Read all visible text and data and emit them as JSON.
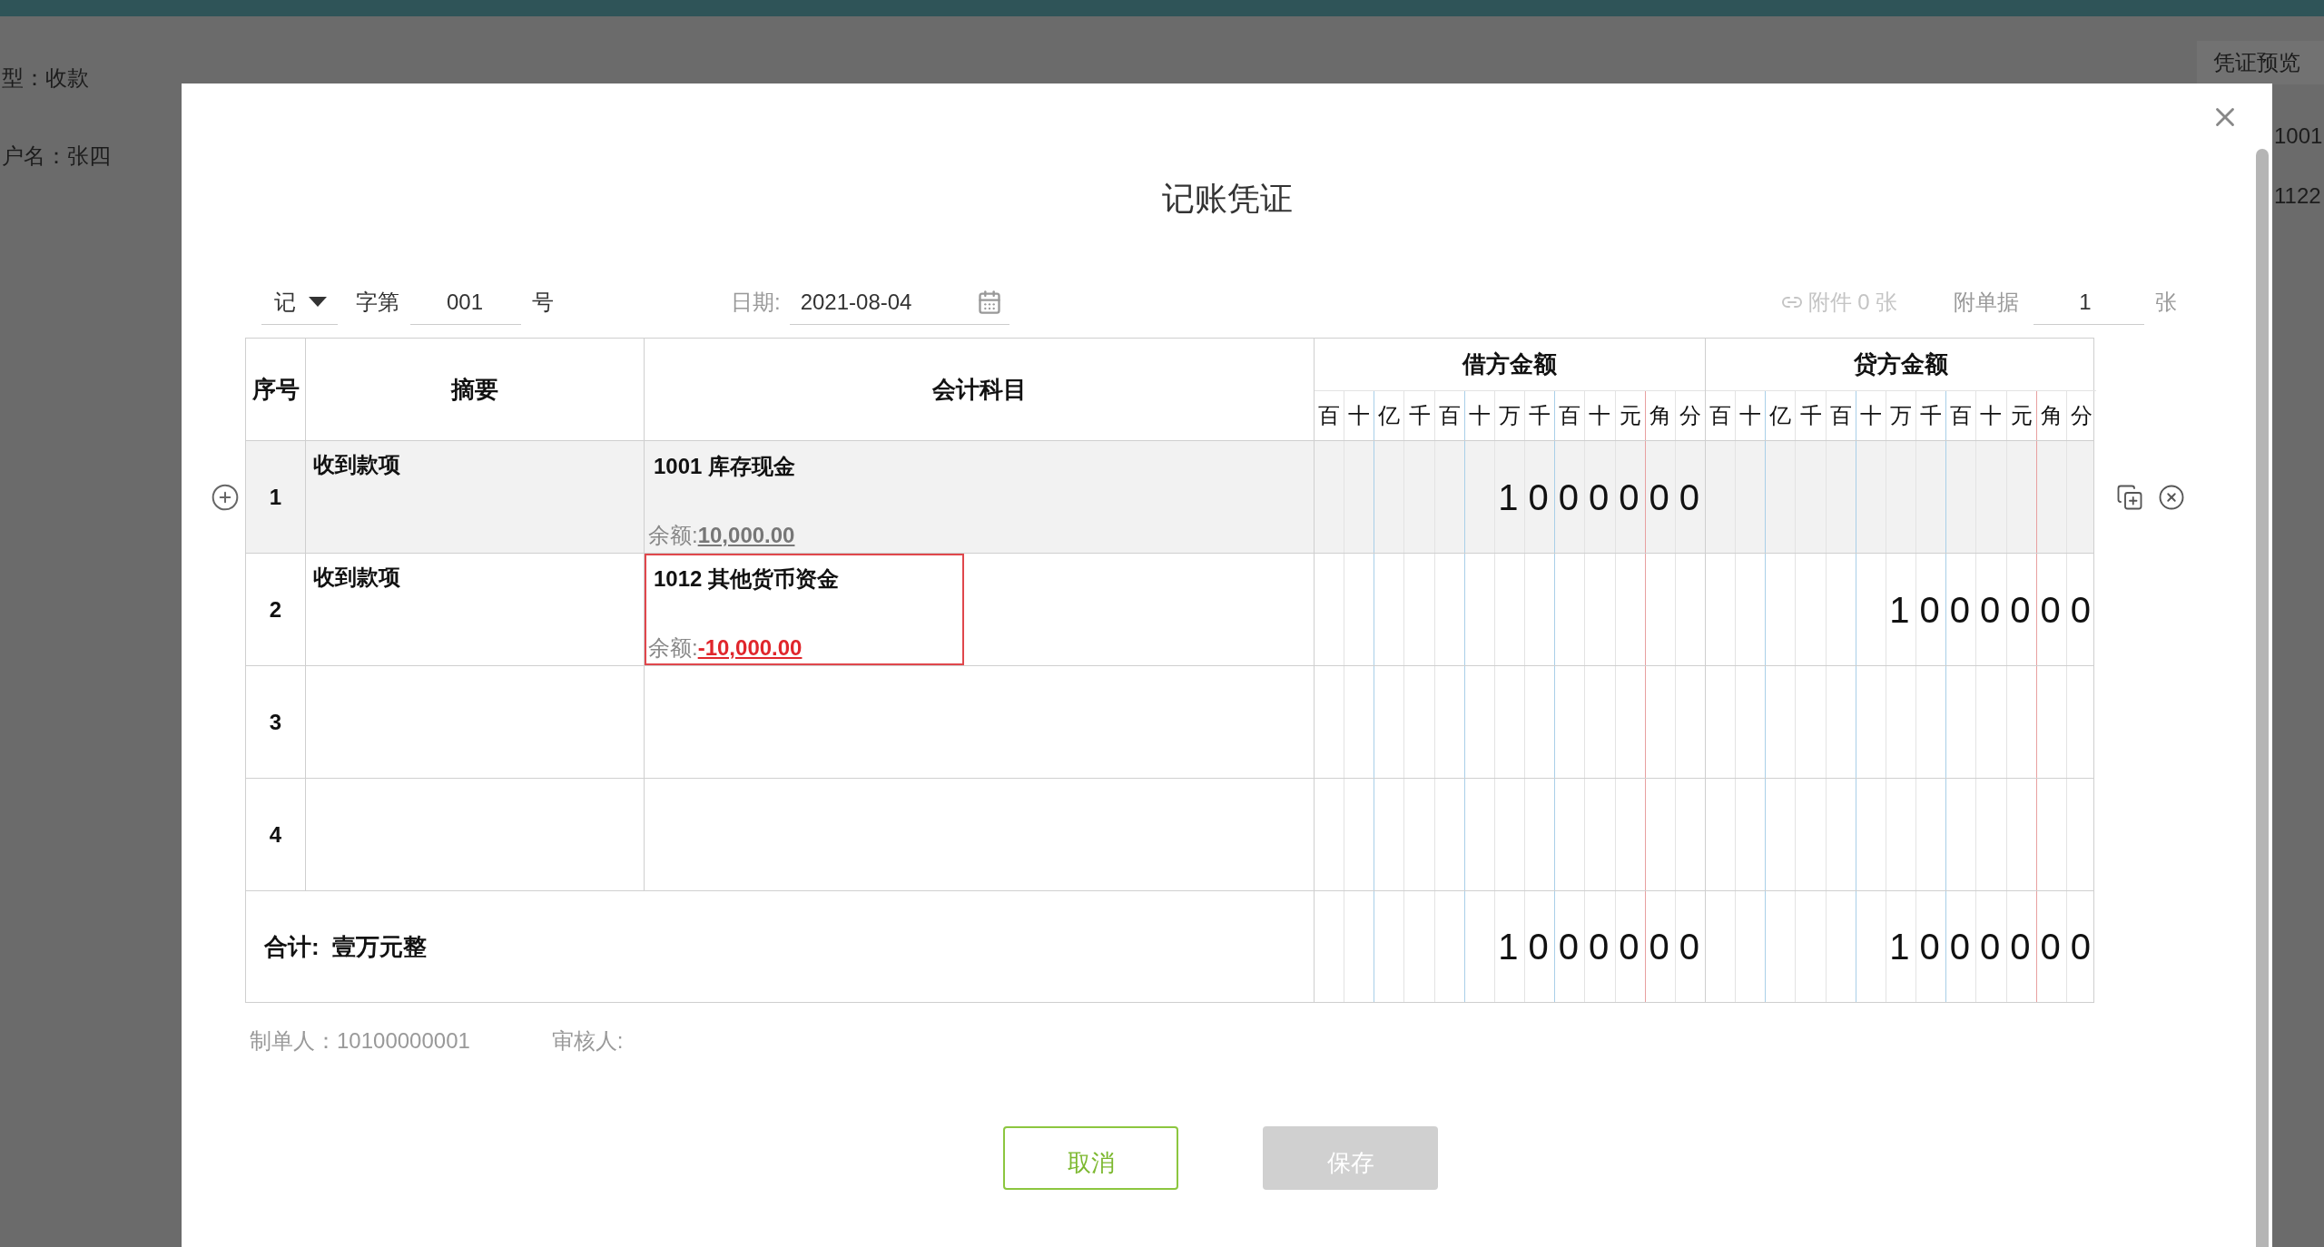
{
  "background": {
    "fields": [
      "型：收款",
      "户名：张四"
    ],
    "preview_tab": "凭证预览",
    "codes": [
      "1001",
      "1122"
    ]
  },
  "dialog": {
    "title": "记账凭证",
    "toolbar": {
      "voucher_type": "记",
      "word_label": "字第",
      "number": "001",
      "number_suffix": "号",
      "date_label": "日期:",
      "date": "2021-08-04",
      "attachment": {
        "label": "附件 0 张",
        "disabled": true
      },
      "docs_label": "附单据",
      "docs_count": "1",
      "docs_unit": "张"
    },
    "table": {
      "columns": {
        "seq": "序号",
        "summary": "摘要",
        "account": "会计科目",
        "debit": "借方金额",
        "credit": "贷方金额"
      },
      "debit_units": [
        "百",
        "十",
        "亿",
        "千",
        "百",
        "十",
        "万",
        "千",
        "百",
        "十",
        "元",
        "角",
        "分"
      ],
      "credit_units": [
        "百",
        "十",
        "亿",
        "千",
        "百",
        "十",
        "万",
        "千",
        "百",
        "十",
        "元",
        "角",
        "分"
      ],
      "rows": [
        {
          "seq": "1",
          "summary": "收到款项",
          "account": "1001 库存现金",
          "balance_label": "余额:",
          "balance": "10,000.00",
          "negative": false,
          "debit": "1000000",
          "hovered": true,
          "invalid": false
        },
        {
          "seq": "2",
          "summary": "收到款项",
          "account": "1012 其他货币资金",
          "balance_label": "余额:",
          "balance": "-10,000.00",
          "negative": true,
          "credit": "1000000",
          "hovered": false,
          "invalid": true
        },
        {
          "seq": "3",
          "hovered": false
        },
        {
          "seq": "4",
          "hovered": false
        }
      ],
      "total": {
        "label": "合计:",
        "words": "壹万元整",
        "debit": "1000000",
        "credit": "1000000"
      }
    },
    "footer": {
      "maker": "制单人：10100000001",
      "reviewer": "审核人:"
    },
    "buttons": [
      {
        "label": "取消",
        "kind": "cancel",
        "disabled": false
      },
      {
        "label": "保存",
        "kind": "save",
        "disabled": true
      }
    ]
  }
}
